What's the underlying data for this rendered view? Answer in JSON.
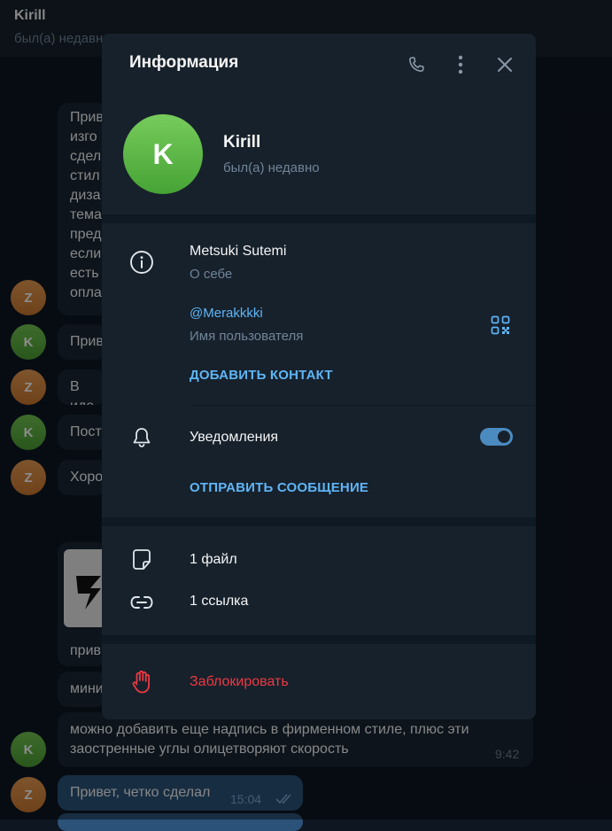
{
  "chat": {
    "title": "Kirill",
    "status": "был(а) недавно",
    "bubbles": [
      {
        "text": "Прив\nизго\nсдел\nстил\nдиза\nтема\nпред\nесли\nесть\nопла"
      },
      {
        "text": "Прив"
      },
      {
        "text": "В иде"
      },
      {
        "text": "Пост"
      },
      {
        "text": "Хоро"
      },
      {
        "text": "прив"
      },
      {
        "text": "мини"
      },
      {
        "text": "можно добавить еще надпись в фирменном стиле, плюс эти\nзаостренные углы олицетворяют скорость"
      },
      {
        "text": "Привет, четко сделал"
      }
    ],
    "times": [
      "9:42",
      "15:04"
    ],
    "avatar_letters": {
      "z": "Z",
      "k": "K"
    },
    "colors": {
      "background": "#0e1621",
      "incoming": "#182533",
      "outgoing": "#2b5278"
    }
  },
  "dialog": {
    "title": "Информация",
    "header_icons": [
      "phone-icon",
      "more-vertical-icon",
      "close-icon"
    ],
    "profile": {
      "avatar_letter": "K",
      "name": "Kirill",
      "status": "был(а) недавно"
    },
    "info": {
      "bio": "Metsuki Sutemi",
      "bio_label": "О себе",
      "username": "@Merakkkki",
      "username_label": "Имя пользователя",
      "add_contact": "ДОБАВИТЬ КОНТАКТ"
    },
    "notifications": {
      "label": "Уведомления",
      "enabled": true,
      "send_message": "ОТПРАВИТЬ СООБЩЕНИЕ"
    },
    "media": {
      "files": "1 файл",
      "links": "1 ссылка"
    },
    "block": "Заблокировать",
    "colors": {
      "accent": "#5eb5f7",
      "danger": "#ec3942",
      "toggle": "#4b8bc0",
      "panel": "#17212b"
    }
  }
}
